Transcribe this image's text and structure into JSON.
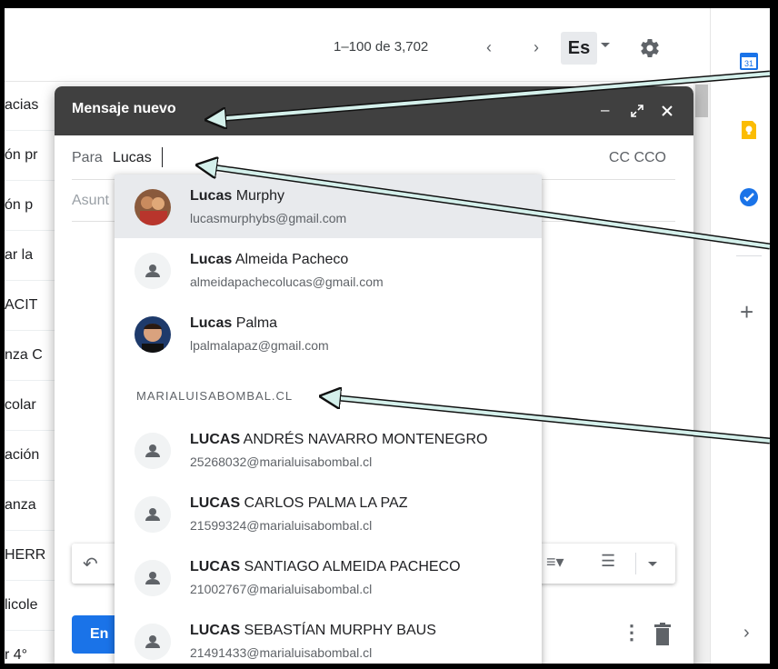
{
  "topbar": {
    "pager_text": "1–100 de 3,702",
    "prev_icon": "chevron-left-icon",
    "next_icon": "chevron-right-icon",
    "language_label": "Es",
    "settings_icon": "gear-icon"
  },
  "inbox_snippets": [
    "acias",
    "ón pr",
    "ón p",
    "ar la",
    "ACIT",
    "nza C",
    "colar",
    "ación",
    "anza",
    "HERR",
    "licole",
    "r 4°"
  ],
  "compose": {
    "title": "Mensaje nuevo",
    "to_label": "Para",
    "to_value": "Lucas",
    "cc_bcc": "CC CCO",
    "subject_label": "Asunt",
    "send_label": "En",
    "header_icons": [
      "minimize-icon",
      "expand-icon",
      "close-icon"
    ]
  },
  "autocomplete": {
    "contacts": [
      {
        "first": "Lucas",
        "rest": " Murphy",
        "email": "lucasmurphybs@gmail.com",
        "avatar": "photo",
        "selected": true
      },
      {
        "first": "Lucas",
        "rest": " Almeida Pacheco",
        "email": "almeidapachecolucas@gmail.com",
        "avatar": "person-icon",
        "selected": false
      },
      {
        "first": "Lucas",
        "rest": " Palma",
        "email": "lpalmalapaz@gmail.com",
        "avatar": "photo",
        "selected": false
      }
    ],
    "section_header": "MARIALUISABOMBAL.CL",
    "domain_contacts": [
      {
        "first": "LUCAS",
        "rest": " ANDRÉS NAVARRO MONTENEGRO",
        "email": "25268032@marialuisabombal.cl"
      },
      {
        "first": "LUCAS",
        "rest": " CARLOS PALMA LA PAZ",
        "email": "21599324@marialuisabombal.cl"
      },
      {
        "first": "LUCAS",
        "rest": " SANTIAGO ALMEIDA PACHECO",
        "email": "21002767@marialuisabombal.cl"
      },
      {
        "first": "LUCAS",
        "rest": " SEBASTÍAN MURPHY BAUS",
        "email": "21491433@marialuisabombal.cl"
      }
    ]
  },
  "sidepanel": {
    "calendar_label": "31",
    "icons": [
      "calendar-icon",
      "keep-icon",
      "tasks-icon",
      "add-icon",
      "chevron-right-icon"
    ],
    "plus": "+",
    "chevron": "›"
  },
  "colors": {
    "header_bg": "#404040",
    "send_blue": "#1a73e8",
    "arrow": "#cfece8"
  }
}
